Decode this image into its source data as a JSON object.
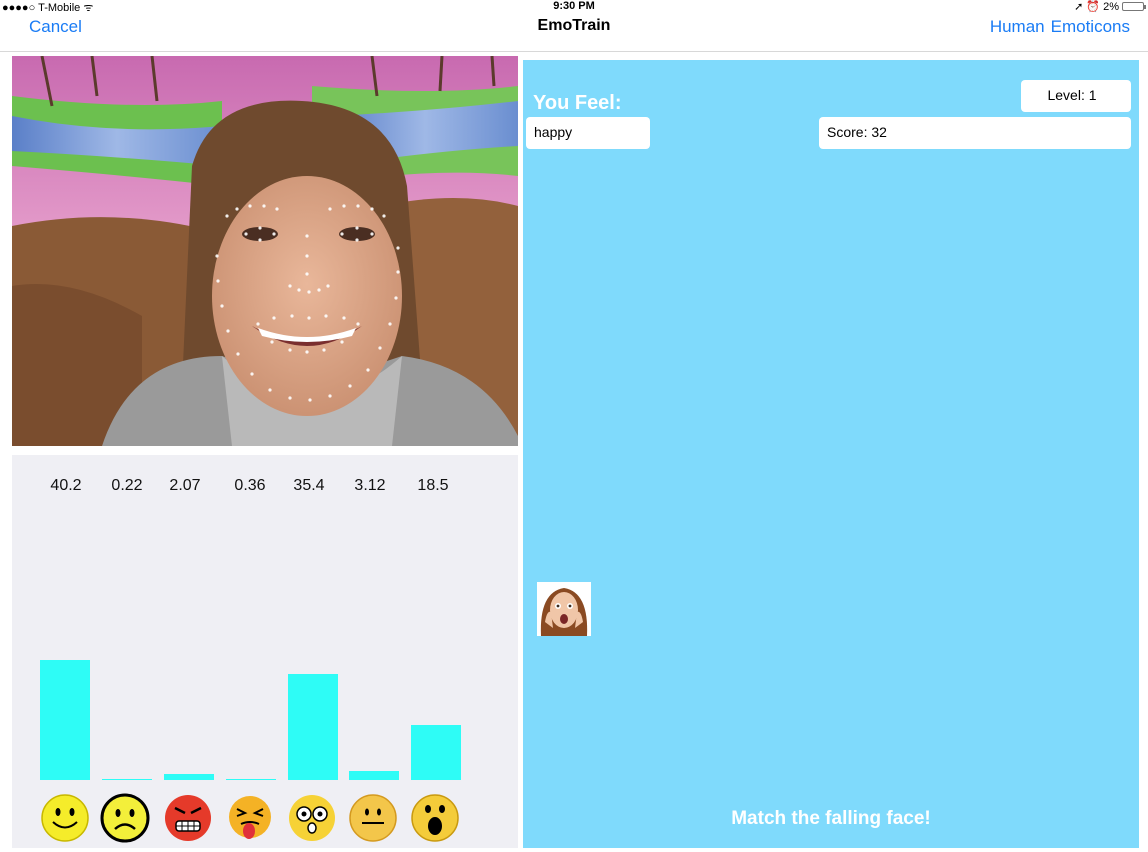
{
  "status": {
    "carrier": "●●●●○ T-Mobile",
    "time": "9:30 PM",
    "battery": "2%"
  },
  "nav": {
    "cancel": "Cancel",
    "title": "EmoTrain",
    "human": "Human",
    "emoticons": "Emoticons"
  },
  "emotions": {
    "values": [
      "40.2",
      "0.22",
      "2.07",
      "0.36",
      "35.4",
      "3.12",
      "18.5"
    ],
    "icons": [
      "happy-emoji-icon",
      "sad-emoji-icon",
      "angry-emoji-icon",
      "disgust-emoji-icon",
      "surprised-emoji-icon",
      "neutral-emoji-icon",
      "fear-emoji-icon"
    ]
  },
  "game": {
    "you_feel_label": "You Feel:",
    "feeling": "happy",
    "level": "Level: 1",
    "score": "Score: 32",
    "match_text": "Match the falling face!"
  },
  "colors": {
    "accent": "#1a7cf5",
    "bar": "#2efcf6",
    "game_bg": "#7fdafc"
  }
}
